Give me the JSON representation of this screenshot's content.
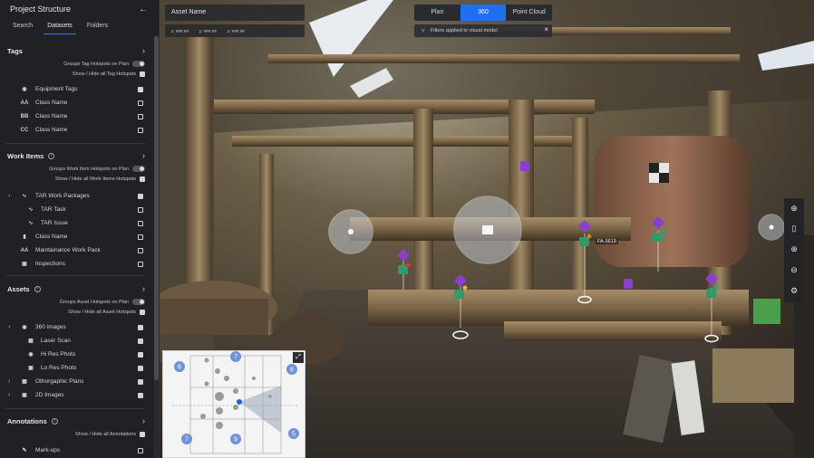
{
  "sidebar": {
    "title": "Project Structure",
    "back_icon": "arrow-left-icon",
    "tabs": [
      {
        "label": "Search",
        "active": false
      },
      {
        "label": "Datasets",
        "active": true
      },
      {
        "label": "Folders",
        "active": false
      }
    ],
    "sections": {
      "tags": {
        "title": "Tags",
        "option_group": "Groups Tag Hotspots on Plan",
        "option_show": "Show / Hide all Tag Hotspots",
        "items": [
          {
            "icon": "tag-icon",
            "label": "Equipment Tags",
            "checked": true
          },
          {
            "icon_text": "AA",
            "label": "Class Name",
            "checked": false
          },
          {
            "icon_text": "BB",
            "label": "Class Name",
            "checked": false
          },
          {
            "icon_text": "CC",
            "label": "Class Name",
            "checked": false
          }
        ]
      },
      "work_items": {
        "title": "Work Items",
        "option_group": "Groups Work Item Hotspots on Plan",
        "option_show": "Show / Hide all Work Items Hotspots",
        "items": [
          {
            "icon": "wave-icon",
            "label": "TAR Work Packages",
            "checked": true,
            "expandable": true
          },
          {
            "icon": "wave-icon",
            "label": "TAR Task",
            "checked": false,
            "indent": true
          },
          {
            "icon": "wave-icon",
            "label": "TAR Issue",
            "checked": false,
            "indent": true
          },
          {
            "icon": "document-icon",
            "label": "Class Name",
            "checked": false
          },
          {
            "icon_text": "AA",
            "label": "Maintainance Work Pack",
            "checked": false
          },
          {
            "icon": "clipboard-icon",
            "label": "Inspections",
            "checked": false
          }
        ]
      },
      "assets": {
        "title": "Assets",
        "option_group": "Groups Asset Hotspots on Plan",
        "option_show": "Show / Hide all Asset Hotspots",
        "items": [
          {
            "icon": "camera-icon",
            "label": "360 images",
            "checked": true,
            "expandable": true
          },
          {
            "icon": "laser-scan-icon",
            "label": "Laser Scan",
            "checked": true,
            "indent": true
          },
          {
            "icon": "camera-icon",
            "label": "Hi Res Photo",
            "checked": true,
            "indent": true
          },
          {
            "icon": "image-icon",
            "label": "Lo Res Photo",
            "checked": true,
            "indent": true
          },
          {
            "icon": "map-icon",
            "label": "Othorgaphic Plans",
            "checked": true,
            "expandable": true
          },
          {
            "icon": "image-icon",
            "label": "2D Images",
            "checked": true,
            "expandable": true
          }
        ]
      },
      "annotations": {
        "title": "Annotations",
        "option_show": "Show / Hide all Annotations",
        "items": [
          {
            "icon": "pen-icon",
            "label": "Mark-ups",
            "checked": false
          }
        ]
      }
    }
  },
  "viewer": {
    "asset_name": "Asset Name",
    "coords": {
      "x": "x: ###.##",
      "y": "y: ###.##",
      "z": "z: ###.##"
    },
    "modes": [
      {
        "label": "Plan",
        "active": false
      },
      {
        "label": "360",
        "active": true
      },
      {
        "label": "Point Cloud",
        "active": false
      }
    ],
    "filter_text": "Filters applied to visual model",
    "hotspot_label": "FA-3619",
    "toolbar": [
      "plus-icon",
      "ruler-icon",
      "zoom-in-icon",
      "zoom-out-icon",
      "gear-icon"
    ],
    "minimap_markers": [
      "6",
      "7",
      "8",
      "8",
      "7",
      "9",
      "5"
    ],
    "colors": {
      "accent": "#1f6ff2",
      "hotspot_purple": "#8a3fd1",
      "hotspot_green": "#2e9c6a"
    }
  }
}
